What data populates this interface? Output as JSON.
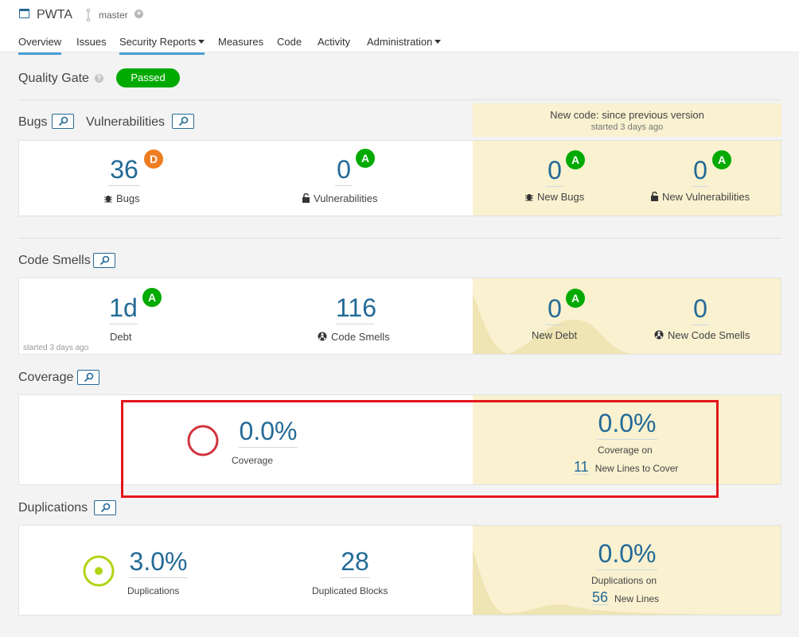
{
  "header": {
    "project": "PWTA",
    "branch": "master",
    "nav": [
      "Overview",
      "Issues",
      "Security Reports",
      "Measures",
      "Code",
      "Activity",
      "Administration"
    ]
  },
  "quality_gate": {
    "label": "Quality Gate",
    "status": "Passed"
  },
  "new_code": {
    "title": "New code: since previous version",
    "started": "started 3 days ago"
  },
  "bugs_vulns": {
    "title_bugs": "Bugs",
    "title_vulns": "Vulnerabilities",
    "bugs": {
      "value": "36",
      "rating": "D",
      "label": "Bugs"
    },
    "vulns": {
      "value": "0",
      "rating": "A",
      "label": "Vulnerabilities"
    },
    "new_bugs": {
      "value": "0",
      "rating": "A",
      "label": "New Bugs"
    },
    "new_vulns": {
      "value": "0",
      "rating": "A",
      "label": "New Vulnerabilities"
    }
  },
  "code_smells": {
    "title": "Code Smells",
    "debt": {
      "value": "1d",
      "rating": "A",
      "label": "Debt"
    },
    "smells": {
      "value": "116",
      "label": "Code Smells"
    },
    "started": "started 3 days ago",
    "new_debt": {
      "value": "0",
      "rating": "A",
      "label": "New Debt"
    },
    "new_smells": {
      "value": "0",
      "label": "New Code Smells"
    }
  },
  "coverage": {
    "title": "Coverage",
    "value": "0.0%",
    "label": "Coverage",
    "new_value": "0.0%",
    "new_label": "Coverage on",
    "new_lines": "11",
    "new_lines_label": "New Lines to Cover"
  },
  "duplications": {
    "title": "Duplications",
    "value": "3.0%",
    "label": "Duplications",
    "blocks": {
      "value": "28",
      "label": "Duplicated Blocks"
    },
    "new_value": "0.0%",
    "new_label": "Duplications on",
    "new_lines": "56",
    "new_lines_label": "New Lines"
  },
  "colors": {
    "accent": "#236a97",
    "passed": "#00aa00",
    "rating_a": "#00aa00",
    "rating_d": "#ed7d20",
    "highlight": "#e3151b",
    "new_code_bg": "#f9f1d0"
  },
  "icons": [
    "project-icon",
    "branch-icon",
    "add-branch-icon",
    "help-icon",
    "drilldown-icon",
    "bug-icon",
    "lock-icon",
    "code-smell-icon",
    "coverage-donut-icon",
    "duplication-donut-icon"
  ]
}
